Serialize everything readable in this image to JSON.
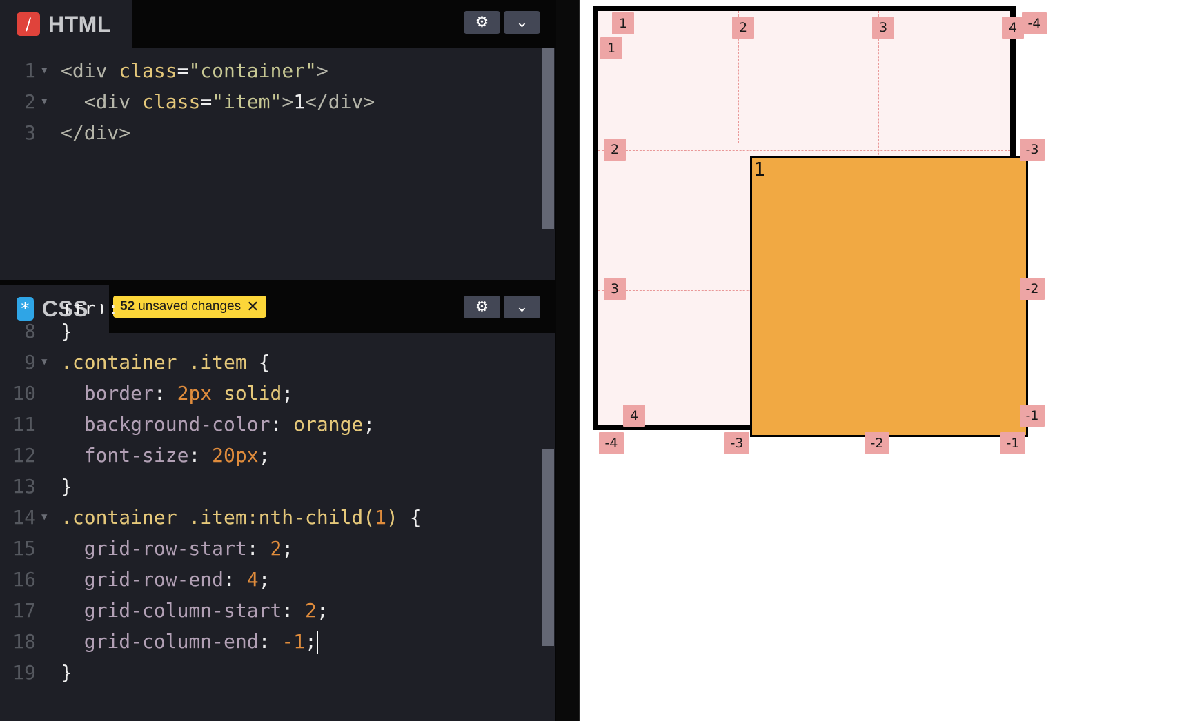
{
  "html_panel": {
    "title": "HTML",
    "icon": "/",
    "lines": [
      {
        "n": "1",
        "tokens": [
          [
            "t-tag",
            "<div "
          ],
          [
            "t-attr",
            "class"
          ],
          [
            "t-plain",
            "="
          ],
          [
            "t-str",
            "\"container\""
          ],
          [
            "t-tag",
            ">"
          ]
        ]
      },
      {
        "n": "2",
        "tokens": [
          [
            "t-plain",
            "  "
          ],
          [
            "t-tag",
            "<div "
          ],
          [
            "t-attr",
            "class"
          ],
          [
            "t-plain",
            "="
          ],
          [
            "t-str",
            "\"item\""
          ],
          [
            "t-tag",
            ">"
          ],
          [
            "t-plain",
            "1"
          ],
          [
            "t-tag",
            "</div>"
          ]
        ]
      },
      {
        "n": "3",
        "tokens": [
          [
            "t-tag",
            "</div>"
          ]
        ]
      }
    ]
  },
  "css_panel": {
    "title": "CSS",
    "icon": "*",
    "badge_count": "52",
    "badge_text": "unsaved changes",
    "badge_close": "✕",
    "partial_line": "1fr);",
    "lines": [
      {
        "n": "8",
        "tokens": [
          [
            "t-plain",
            "}"
          ]
        ]
      },
      {
        "n": "9",
        "tokens": [
          [
            "t-sel",
            ".container .item"
          ],
          [
            "t-plain",
            " {"
          ]
        ]
      },
      {
        "n": "10",
        "tokens": [
          [
            "t-plain",
            "  "
          ],
          [
            "t-prop",
            "border"
          ],
          [
            "t-plain",
            ": "
          ],
          [
            "t-num",
            "2px"
          ],
          [
            "t-plain",
            " "
          ],
          [
            "t-sel",
            "solid"
          ],
          [
            "t-plain",
            ";"
          ]
        ]
      },
      {
        "n": "11",
        "tokens": [
          [
            "t-plain",
            "  "
          ],
          [
            "t-prop",
            "background-color"
          ],
          [
            "t-plain",
            ": "
          ],
          [
            "t-sel",
            "orange"
          ],
          [
            "t-plain",
            ";"
          ]
        ]
      },
      {
        "n": "12",
        "tokens": [
          [
            "t-plain",
            "  "
          ],
          [
            "t-prop",
            "font-size"
          ],
          [
            "t-plain",
            ": "
          ],
          [
            "t-num",
            "20px"
          ],
          [
            "t-plain",
            ";"
          ]
        ]
      },
      {
        "n": "13",
        "tokens": [
          [
            "t-plain",
            "}"
          ]
        ]
      },
      {
        "n": "14",
        "tokens": [
          [
            "t-sel",
            ".container .item:nth-child("
          ],
          [
            "t-num",
            "1"
          ],
          [
            "t-sel",
            ")"
          ],
          [
            "t-plain",
            " {"
          ]
        ]
      },
      {
        "n": "15",
        "tokens": [
          [
            "t-plain",
            "  "
          ],
          [
            "t-prop",
            "grid-row-start"
          ],
          [
            "t-plain",
            ": "
          ],
          [
            "t-num",
            "2"
          ],
          [
            "t-plain",
            ";"
          ]
        ]
      },
      {
        "n": "16",
        "tokens": [
          [
            "t-plain",
            "  "
          ],
          [
            "t-prop",
            "grid-row-end"
          ],
          [
            "t-plain",
            ": "
          ],
          [
            "t-num",
            "4"
          ],
          [
            "t-plain",
            ";"
          ]
        ]
      },
      {
        "n": "17",
        "tokens": [
          [
            "t-plain",
            "  "
          ],
          [
            "t-prop",
            "grid-column-start"
          ],
          [
            "t-plain",
            ": "
          ],
          [
            "t-num",
            "2"
          ],
          [
            "t-plain",
            ";"
          ]
        ]
      },
      {
        "n": "18",
        "tokens": [
          [
            "t-plain",
            "  "
          ],
          [
            "t-prop",
            "grid-column-end"
          ],
          [
            "t-plain",
            ": "
          ],
          [
            "t-num",
            "-1"
          ],
          [
            "t-plain",
            ";"
          ]
        ],
        "cursor": true
      },
      {
        "n": "19",
        "tokens": [
          [
            "t-plain",
            "}"
          ]
        ]
      }
    ]
  },
  "preview": {
    "item_text": "1",
    "line_labels": {
      "top": [
        "1",
        "2",
        "3",
        "4"
      ],
      "top_right": "-4",
      "left": [
        "1",
        "2",
        "3",
        "4"
      ],
      "right": [
        "-3",
        "-2",
        "-1"
      ],
      "bottom": [
        "-4",
        "-3",
        "-2",
        "-1"
      ]
    }
  },
  "colors": {
    "editor_bg": "#1e1f26",
    "grid_bg": "#fdf2f2",
    "item_bg": "#f1a943",
    "label_bg": "#eda5a5",
    "badge_bg": "#fcd639"
  }
}
